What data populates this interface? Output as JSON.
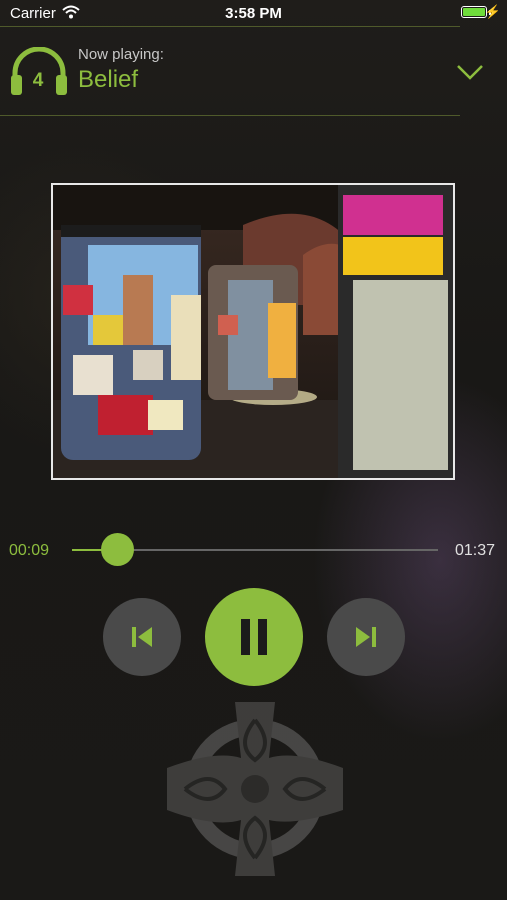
{
  "status_bar": {
    "carrier": "Carrier",
    "time": "3:58 PM"
  },
  "header": {
    "track_number": "4",
    "now_playing_label": "Now playing:",
    "title": "Belief"
  },
  "player": {
    "elapsed": "00:09",
    "duration": "01:37",
    "progress_fraction": 0.09
  },
  "colors": {
    "accent": "#8dbd3e",
    "button_gray": "#4a4a4a",
    "background": "#1c1b19"
  },
  "icons": {
    "status": [
      "wifi-icon",
      "battery-icon",
      "charging-icon"
    ],
    "header": [
      "headphones-icon",
      "chevron-down-icon"
    ],
    "controls": [
      "previous-icon",
      "pause-icon",
      "next-icon"
    ],
    "decor": [
      "celtic-cross-icon"
    ]
  }
}
